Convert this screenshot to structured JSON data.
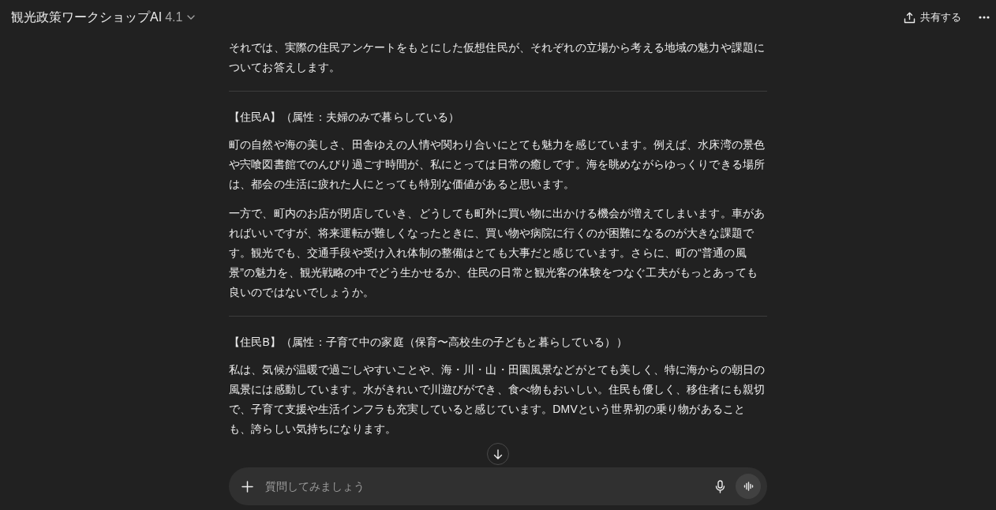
{
  "header": {
    "title": "観光政策ワークショップAI",
    "model_version": "4.1",
    "share_button": "共有する"
  },
  "messages": [
    {
      "kind": "paragraph",
      "text": "それでは、実際の住民アンケートをもとにした仮想住民が、それぞれの立場から考える地域の魅力や課題についてお答えします。"
    },
    {
      "kind": "divider"
    },
    {
      "kind": "heading",
      "text": "【住民A】（属性：夫婦のみで暮らしている）"
    },
    {
      "kind": "paragraph",
      "text": "町の自然や海の美しさ、田舎ゆえの人情や関わり合いにとても魅力を感じています。例えば、水床湾の景色や宍喰図書館でのんびり過ごす時間が、私にとっては日常の癒しです。海を眺めながらゆっくりできる場所は、都会の生活に疲れた人にとっても特別な価値があると思います。"
    },
    {
      "kind": "paragraph",
      "text": "一方で、町内のお店が閉店していき、どうしても町外に買い物に出かける機会が増えてしまいます。車があればいいですが、将来運転が難しくなったときに、買い物や病院に行くのが困難になるのが大きな課題です。観光でも、交通手段や受け入れ体制の整備はとても大事だと感じています。さらに、町の“普通の風景”の魅力を、観光戦略の中でどう生かせるか、住民の日常と観光客の体験をつなぐ工夫がもっとあっても良いのではないでしょうか。"
    },
    {
      "kind": "divider"
    },
    {
      "kind": "heading",
      "text": "【住民B】（属性：子育て中の家庭（保育〜高校生の子どもと暮らしている））"
    },
    {
      "kind": "paragraph",
      "text": "私は、気候が温暖で過ごしやすいことや、海・川・山・田園風景などがとても美しく、特に海からの朝日の風景には感動しています。水がきれいで川遊びができ、食べ物もおいしい。住民も優しく、移住者にも親切で、子育て支援や生活インフラも充実していると感じています。DMVという世界初の乗り物があることも、誇らしい気持ちになります。"
    }
  ],
  "composer": {
    "placeholder": "質問してみましょう"
  }
}
